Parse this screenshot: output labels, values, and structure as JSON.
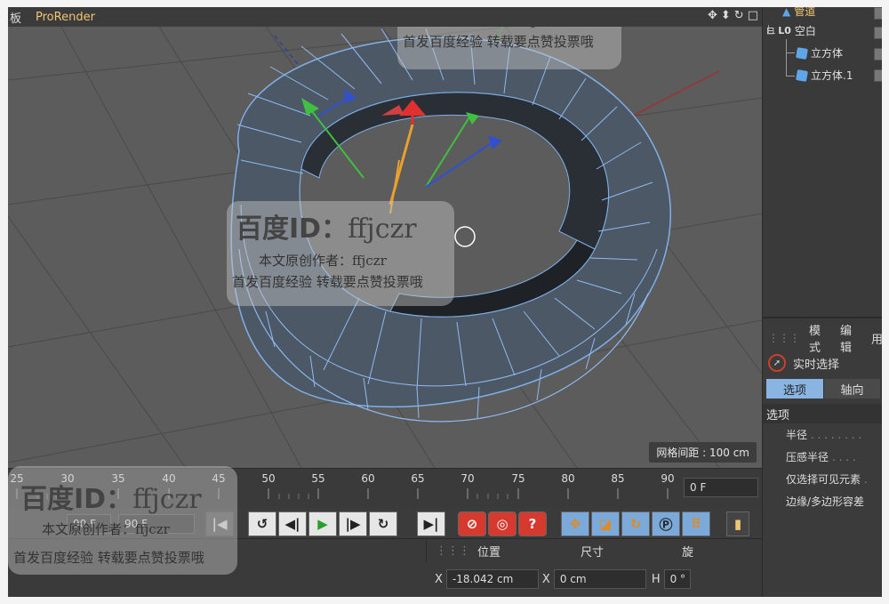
{
  "viewport": {
    "menu_board": "板",
    "menu_prorender": "ProRender",
    "nav_icons": [
      "move-view-icon",
      "zoom-view-icon",
      "rotate-view-icon",
      "maximize-view-icon"
    ],
    "grid_spacing": "网格间距 : 100 cm"
  },
  "object_manager": {
    "items": [
      {
        "label": "管道",
        "icon": "tube-icon"
      },
      {
        "label": "空白",
        "icon": "null-icon"
      },
      {
        "label": "立方体",
        "icon": "cube-icon"
      },
      {
        "label": "立方体.1",
        "icon": "cube-icon"
      }
    ]
  },
  "attributes": {
    "menu": [
      "模式",
      "编辑",
      "用"
    ],
    "tool_name": "实时选择",
    "tabs": [
      "选项",
      "轴向"
    ],
    "section_title": "选项",
    "options": [
      "半径",
      "压感半径",
      "仅选择可见元素",
      "边缘/多边形容差"
    ]
  },
  "timeline": {
    "ticks": [
      "25",
      "30",
      "35",
      "40",
      "45",
      "50",
      "55",
      "60",
      "65",
      "70",
      "75",
      "80",
      "85",
      "90"
    ],
    "current_frame": "0 F"
  },
  "playback": {
    "start_field": "90 F",
    "end_field": "90 F"
  },
  "coordinates": {
    "headers": [
      "位置",
      "尺寸",
      "旋"
    ],
    "x_label": "X",
    "position_x": "-18.042 cm",
    "size_x_label": "X",
    "size_x": "0 cm",
    "rot_label": "H",
    "rot_h": "0 °"
  },
  "watermarks": {
    "id_text": "百度ID：",
    "id_name": "ffjczr",
    "line1": "本文原创作者：ffjczr",
    "line2": "首发百度经验 转载要点赞投票哦"
  }
}
